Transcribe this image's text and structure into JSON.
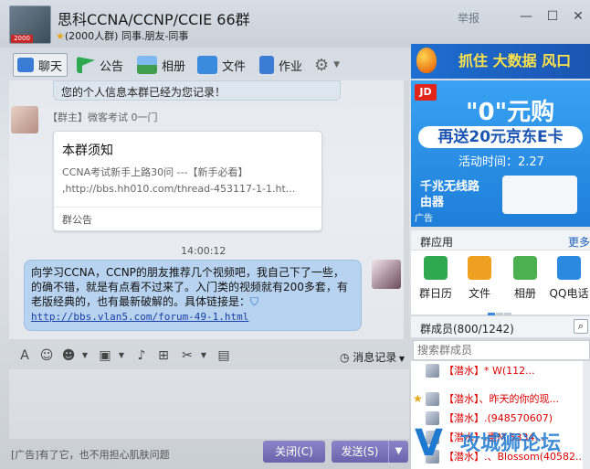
{
  "window": {
    "group_name": "思科CCNA/CCNP/CCIE 66群",
    "group_meta": "(2000人群) 同事.朋友-同事",
    "avatar_badge": "2000",
    "report_label": "举报",
    "minimize_glyph": "—",
    "maximize_glyph": "☐",
    "close_glyph": "✕"
  },
  "tabs": [
    {
      "label": "聊天",
      "icon": "chat-icon",
      "color": "#3a7bd5"
    },
    {
      "label": "公告",
      "icon": "flag-icon",
      "color": "#2fa84f"
    },
    {
      "label": "相册",
      "icon": "photo-icon",
      "color": "#3a7bd5"
    },
    {
      "label": "文件",
      "icon": "folder-icon",
      "color": "#3a8be0"
    },
    {
      "label": "作业",
      "icon": "homework-icon",
      "color": "#3a7bd5"
    }
  ],
  "chat": {
    "system_notice": "您的个人信息本群已经为您记录！",
    "owner_name": "【群主】微客考试 0一门",
    "notice_card": {
      "title": "本群须知",
      "line1": "CCNA考试新手上路30问 ---【新手必看】",
      "line2": ",http://bbs.hh010.com/thread-453117-1-1.ht...",
      "footer": "群公告"
    },
    "timestamp": "14:00:12",
    "message_text": "向学习CCNA，CCNP的朋友推荐几个视频吧，我自己下了一些，的确不错，就是有点看不过来了。入门类的视频就有200多套，有老版经典的，也有最新破解的。具体链接是：",
    "message_link": "http://bbs.vlan5.com/forum-49-1.html"
  },
  "input": {
    "history_label": "消息记录",
    "ad_text": "[广告]有了它，也不用担心肌肤问题",
    "close_label": "关闭(C)",
    "send_label": "发送(S)"
  },
  "right": {
    "banner_text": "抓住 大数据 风口",
    "jd": {
      "logo": "JD",
      "headline": "\"0\"元购",
      "sub": "再送20元京东E卡",
      "time": "活动时间：2.27",
      "product": "千兆无线路由器",
      "ad_tag": "广告"
    },
    "apps_title": "群应用",
    "apps_more": "更多",
    "apps": [
      {
        "label": "群日历",
        "icon": "calendar-icon",
        "color": "#2fa84f"
      },
      {
        "label": "文件",
        "icon": "folder-icon",
        "color": "#f0a020"
      },
      {
        "label": "相册",
        "icon": "photo-icon",
        "color": "#4caf50"
      },
      {
        "label": "QQ电话",
        "icon": "phone-icon",
        "color": "#2b8ae0"
      }
    ],
    "members_title": "群成员(800/1242)",
    "member_search_placeholder": "搜索群成员",
    "members": [
      {
        "name": "【潜水】*           W(112...",
        "star": false
      },
      {
        "name": "【潜水】、昨天的你的现...",
        "star": true
      },
      {
        "name": "【潜水】.(948570607)",
        "star": false
      },
      {
        "name": "【潜水】.惠M 5334...",
        "star": false
      },
      {
        "name": "【潜水】.、Blossom(40582...",
        "star": false
      }
    ],
    "watermark": "攻城狮论坛"
  }
}
